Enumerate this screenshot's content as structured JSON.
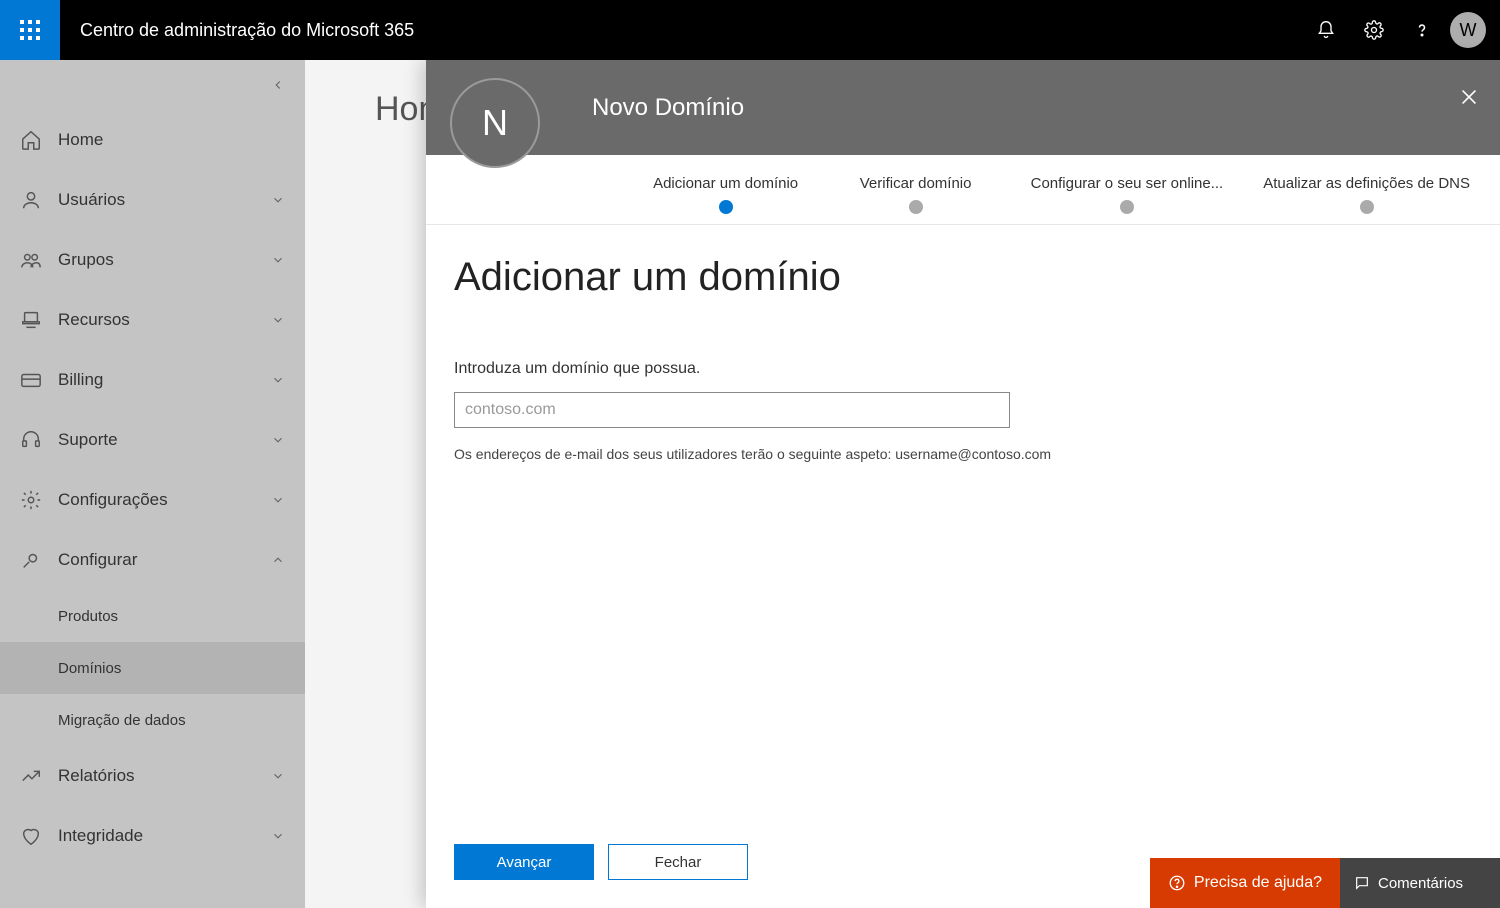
{
  "header": {
    "title": "Centro de administração do Microsoft 365",
    "avatar_initial": "W"
  },
  "sidebar": {
    "items": [
      {
        "label": "Home",
        "icon": "home-icon",
        "expandable": false
      },
      {
        "label": "Usuários",
        "icon": "users-icon",
        "expandable": true
      },
      {
        "label": "Grupos",
        "icon": "groups-icon",
        "expandable": true
      },
      {
        "label": "Recursos",
        "icon": "resources-icon",
        "expandable": true
      },
      {
        "label": "Billing",
        "icon": "billing-icon",
        "expandable": true
      },
      {
        "label": "Suporte",
        "icon": "support-icon",
        "expandable": true
      },
      {
        "label": "Configurações",
        "icon": "settings-icon",
        "expandable": true
      },
      {
        "label": "Configurar",
        "icon": "configure-icon",
        "expandable": true,
        "expanded": true
      },
      {
        "label": "Relatórios",
        "icon": "reports-icon",
        "expandable": true
      },
      {
        "label": "Integridade",
        "icon": "health-icon",
        "expandable": true
      }
    ],
    "configure_sub": [
      {
        "label": "Produtos",
        "selected": false
      },
      {
        "label": "Domínios",
        "selected": true
      },
      {
        "label": "Migração de dados",
        "selected": false
      }
    ]
  },
  "main": {
    "breadcrumb": "Hom"
  },
  "panel": {
    "circle_initial": "N",
    "title": "Novo Domínio",
    "steps": [
      {
        "label": "Adicionar um domínio",
        "active": true
      },
      {
        "label": "Verificar domínio",
        "active": false
      },
      {
        "label": "Configurar o seu ser online...",
        "active": false
      },
      {
        "label": "Atualizar as definições de DNS",
        "active": false
      }
    ],
    "heading": "Adicionar um domínio",
    "input_label": "Introduza um domínio que possua.",
    "input_placeholder": "contoso.com",
    "input_value": "",
    "hint": "Os endereços de e-mail dos seus utilizadores terão o seguinte aspeto: username@contoso.com",
    "primary_btn": "Avançar",
    "secondary_btn": "Fechar"
  },
  "footer": {
    "help": "Precisa de ajuda?",
    "feedback": "Comentários"
  }
}
